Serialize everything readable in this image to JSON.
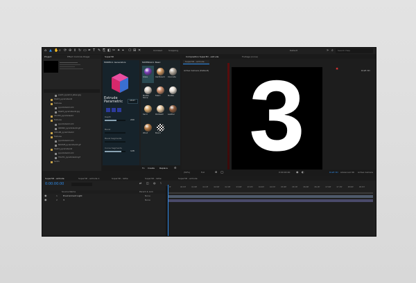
{
  "toolbar": {
    "extra_left": "Unlinked",
    "snapping": "Snapping",
    "workspace": "Default",
    "search_placeholder": "Search Help"
  },
  "project_panel": {
    "tabs": [
      "Project",
      "Effect Controls Diagw",
      "Super3D"
    ],
    "files": [
      "pre03_pyramid_albeo.jpg",
      "tQalt3_pyramidsolid",
      "Textures",
      "pyramidsolid.xml",
      "tQalt3_pyramidsolid.jpg",
      "03xY83_pyramidsolid",
      "Textures",
      "pyramidsolid.xml",
      "040002_pyramidsolid.gif",
      "16Ov9R_pyramidsolid",
      "Textures",
      "pyramidsolid.xml",
      "BaV9V8_pyramidsolid.gif",
      "tQalt3_pyramidsolid",
      "pyramidsolid.xml",
      "T0xdY1_pyramidsolid.gif",
      "Solids"
    ]
  },
  "super3d": {
    "models_header": "MODELS: Generators",
    "materials_header": "MATERIALS: Basic",
    "extrude_title": "Extrude Parametric",
    "reset_label": "RESET",
    "params": [
      {
        "label": "Depth",
        "value": "200"
      },
      {
        "label": "Bevel",
        "value": ""
      },
      {
        "label": "Bevel Segments",
        "value": ""
      },
      {
        "label": "Curve Segments",
        "value": "128"
      }
    ],
    "materials": [
      {
        "name": "Glass",
        "color": "#7a3fb8"
      },
      {
        "name": "Cardboard",
        "color": "#c9935e"
      },
      {
        "name": "Concrete",
        "color": "#b0a79b"
      },
      {
        "name": "Marble Stone",
        "color": "#d9cfc3"
      },
      {
        "name": "Fabric",
        "color": "#c98c6a"
      },
      {
        "name": "Marble",
        "color": "#e7dfd6"
      },
      {
        "name": "Sand",
        "color": "#d6a86c"
      },
      {
        "name": "Paintwall",
        "color": "#e2c59e"
      },
      {
        "name": "Leather",
        "color": "#8b5a3c"
      },
      {
        "name": "Wood",
        "color": "#b67a43"
      },
      {
        "name": "Board",
        "color": "#ffffff"
      }
    ],
    "footer": {
      "fx": "Fx",
      "create": "Create",
      "replace": "Replace"
    }
  },
  "composition": {
    "tabs": [
      "Composition Super3D - extrude",
      "Footage (none)"
    ],
    "subtab": "Super3D - extrude",
    "camera": "Active Camera (Default)",
    "renderer": "Draft 3D",
    "big_number": "3",
    "footer": {
      "zoom": "(50%)",
      "resolution": "Full",
      "timecode": "0:00:00:00",
      "renderer": "Draft 3D",
      "view": "Advanced 3D",
      "camera": "Active Camera"
    }
  },
  "timeline": {
    "tabs": [
      "Super3D - extrude",
      "Super3D - extrude 1",
      "Super3D - lathe",
      "Super3D - lathe",
      "Super3D - extrude"
    ],
    "timecode": "0:00:00:00",
    "columns": {
      "source": "Source Name",
      "parent": "Parent & Link"
    },
    "layers": [
      {
        "num": "1",
        "name": "Environment Light",
        "parent": "None"
      },
      {
        "num": "2",
        "name": "3",
        "parent": "None"
      }
    ],
    "ruler": [
      "0f",
      "00:15f",
      "01:00f",
      "01:15f",
      "02:00f",
      "02:15f",
      "03:00f",
      "03:15f",
      "04:00f",
      "04:15f",
      "05:00f",
      "05:15f",
      "06:00f",
      "06:15f",
      "07:00f",
      "07:15f",
      "08:00f",
      "08:15f"
    ]
  },
  "colors": {
    "accent": "#2d8ceb",
    "panel": "#232323",
    "bg": "#1b1b1b"
  }
}
